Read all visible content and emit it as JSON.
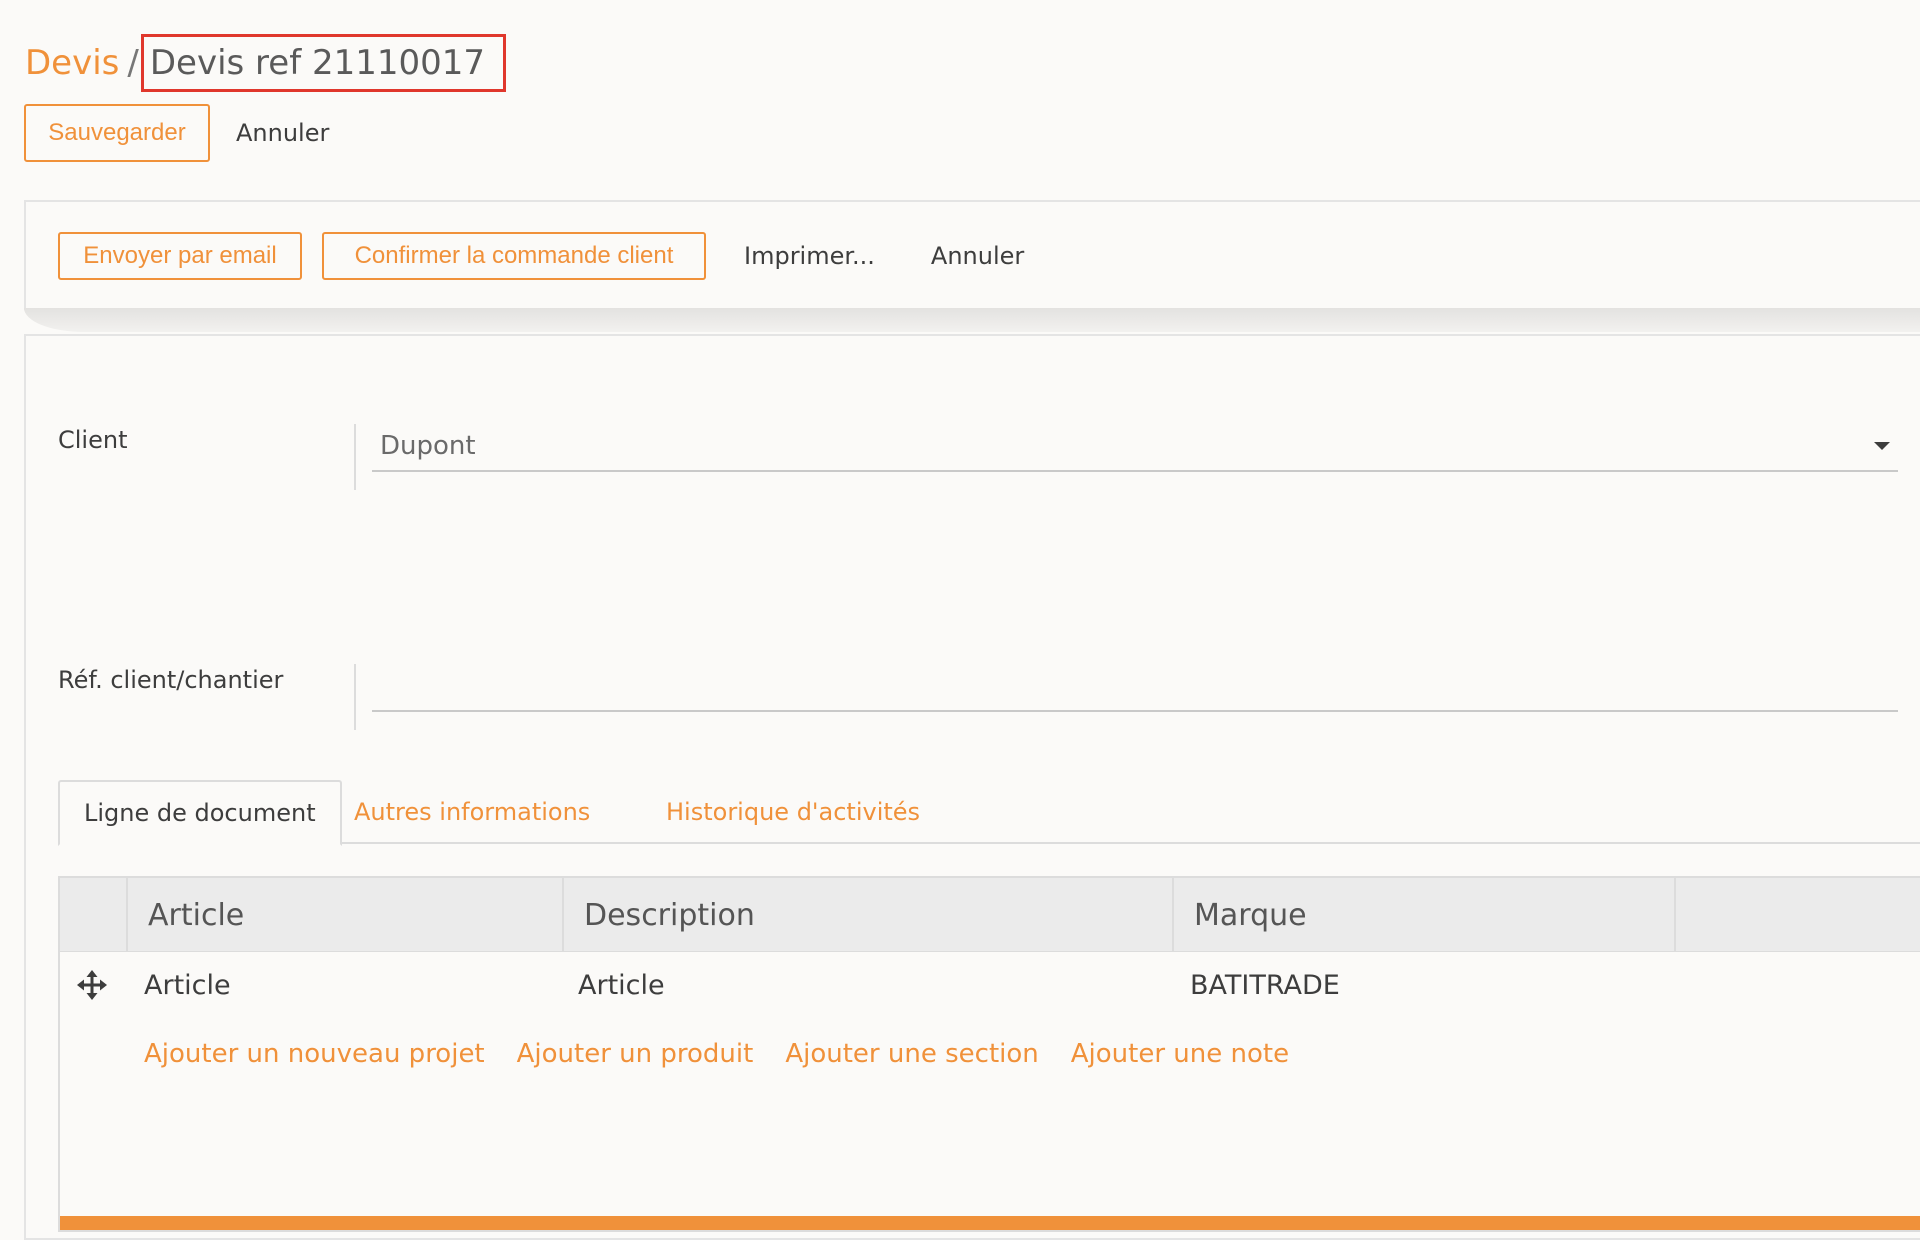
{
  "breadcrumb": {
    "root": "Devis",
    "separator": "/",
    "current": "Devis ref 21110017"
  },
  "control_panel": {
    "save_label": "Sauvegarder",
    "discard_label": "Annuler"
  },
  "statusbar": {
    "send_email_label": "Envoyer par email",
    "confirm_label": "Confirmer la commande client",
    "print_label": "Imprimer...",
    "cancel_label": "Annuler"
  },
  "form": {
    "client": {
      "label": "Client",
      "value": "Dupont"
    },
    "reference": {
      "label": "Réf. client/chantier",
      "value": ""
    }
  },
  "tabs": [
    {
      "label": "Ligne de document",
      "active": true
    },
    {
      "label": "Autres informations",
      "active": false
    },
    {
      "label": "Historique d'activités",
      "active": false
    }
  ],
  "lines_table": {
    "columns": [
      "Article",
      "Description",
      "Marque"
    ],
    "rows": [
      {
        "article": "Article",
        "description": "Article",
        "marque": "BATITRADE"
      }
    ],
    "add_links": [
      "Ajouter un nouveau projet",
      "Ajouter un produit",
      "Ajouter une section",
      "Ajouter une note"
    ]
  },
  "colors": {
    "accent": "#f0913a",
    "highlight_box": "#e0372c",
    "background": "#fbfaf8"
  },
  "icons": {
    "drag_handle": "move-arrows-icon",
    "dropdown": "caret-down-icon"
  }
}
